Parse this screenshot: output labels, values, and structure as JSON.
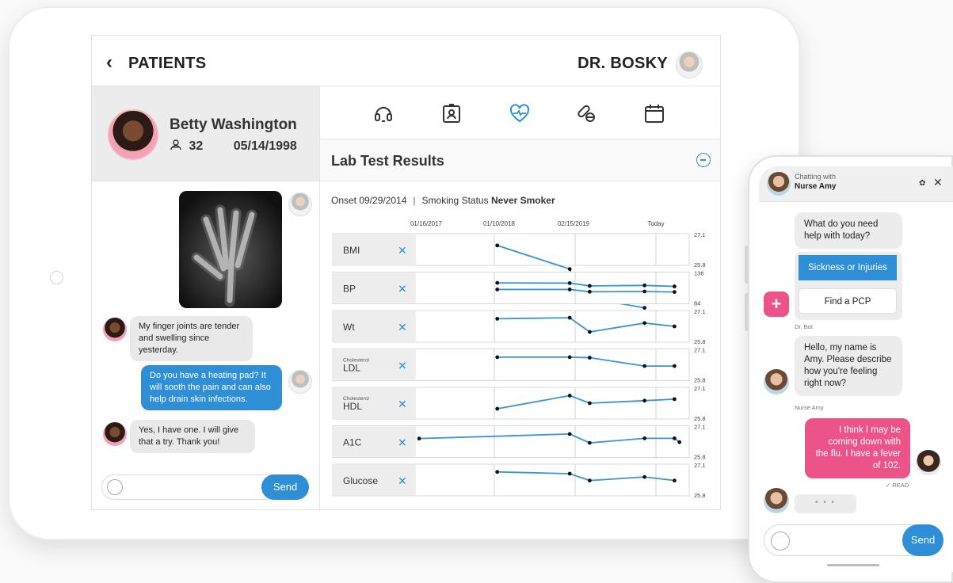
{
  "tablet": {
    "header": {
      "back_label": "PATIENTS",
      "doctor_name": "DR. BOSKY"
    },
    "patient": {
      "name": "Betty Washington",
      "age": "32",
      "dob": "05/14/1998"
    },
    "lab": {
      "title": "Lab Test Results",
      "onset_label": "Onset 09/29/2014",
      "smoking_label": "Smoking Status",
      "smoking_value": "Never Smoker"
    },
    "chat": {
      "messages": [
        "My finger joints are tender and swelling since yesterday.",
        "Do you have a heating pad? It will sooth the pain and can also help drain skin infections.",
        "Yes, I have one. I will give that a try. Thank you!"
      ],
      "send_label": "Send"
    }
  },
  "chart_data": {
    "type": "line",
    "x": [
      "01/16/2017",
      "01/10/2018",
      "02/15/2019",
      "Today"
    ],
    "rows": [
      {
        "label": "BMI",
        "sub": "",
        "max": "27.1",
        "min": "25.8",
        "series": [
          [
            null,
            2,
            0.34,
            0.62,
            1.27,
            0.66,
            2.35,
            0.92,
            2.8,
            1.04
          ]
        ]
      },
      {
        "label": "BP",
        "sub": "",
        "max": "136",
        "min": "84",
        "series": [
          [
            null,
            2,
            0.3,
            0.62,
            0.31,
            0.7,
            0.42,
            0.92,
            0.4,
            1.04,
            0.44
          ],
          [
            null,
            2,
            0.56,
            0.62,
            0.56,
            0.7,
            0.65,
            0.92,
            0.64,
            1.04,
            0.66
          ]
        ]
      },
      {
        "label": "Wt",
        "sub": "",
        "max": "27.1",
        "min": "25.8",
        "series": [
          [
            null,
            2,
            0.2,
            0.62,
            0.16,
            0.7,
            0.72,
            0.92,
            0.37,
            1.04,
            0.5
          ]
        ]
      },
      {
        "label": "LDL",
        "sub": "Cholesterol",
        "max": "27.1",
        "min": "25.8",
        "series": [
          [
            null,
            2,
            0.2,
            0.62,
            0.2,
            0.7,
            0.22,
            0.92,
            0.55,
            1.04,
            0.55
          ]
        ]
      },
      {
        "label": "HDL",
        "sub": "Cholesterol",
        "max": "27.1",
        "min": "25.8",
        "series": [
          [
            null,
            2,
            0.72,
            0.62,
            0.2,
            0.7,
            0.5,
            0.92,
            0.4,
            1.04,
            0.34
          ]
        ]
      },
      {
        "label": "A1C",
        "sub": "",
        "max": "27.1",
        "min": "25.8",
        "series": [
          [
            0.38,
            0.62,
            0.2,
            0.7,
            0.55,
            0.92,
            0.37,
            1.04,
            0.37,
            1.08,
            0.52
          ]
        ]
      },
      {
        "label": "Glucose",
        "sub": "",
        "max": "27.1",
        "min": "25.8",
        "series": [
          [
            null,
            2,
            0.18,
            0.62,
            0.25,
            0.7,
            0.52,
            0.92,
            0.38,
            1.04,
            0.52
          ]
        ]
      }
    ]
  },
  "phone": {
    "header": {
      "chatting_with": "Chatting with",
      "name": "Nurse Amy"
    },
    "bot_question": "What do you need help with today?",
    "options": [
      "Sickness or Injuries",
      "Find a PCP"
    ],
    "bot_label": "Dr. Bot",
    "nurse_message": "Hello, my name is Amy. Please describe how you're feeling right now?",
    "nurse_label": "Nurse Amy",
    "user_message": "I think I may be coming down with the flu. I have a fever of 102.",
    "read_label": "✓ READ",
    "typing": "• • •",
    "send_label": "Send"
  }
}
